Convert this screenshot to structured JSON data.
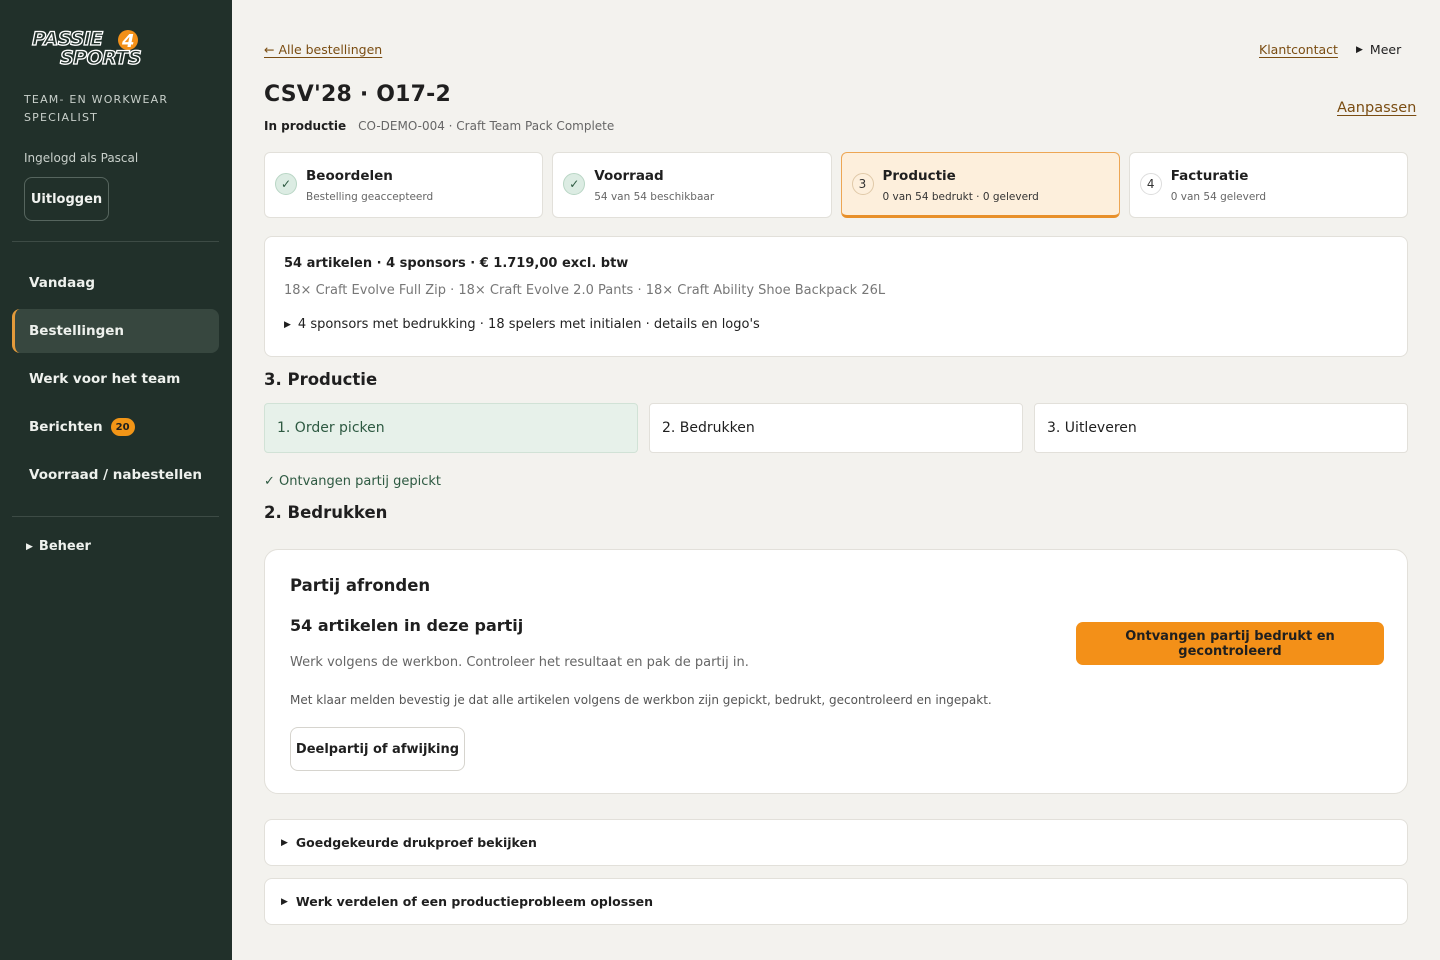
{
  "sidebar": {
    "logo_text_top": "PASSIE",
    "logo_text_num": "4",
    "logo_text_bottom": "SPORTS",
    "tagline": "TEAM- EN WORKWEAR SPECIALIST",
    "logged_in": "Ingelogd als Pascal",
    "logout_label": "Uitloggen",
    "nav": [
      {
        "label": "Vandaag"
      },
      {
        "label": "Bestellingen"
      },
      {
        "label": "Werk voor het team"
      },
      {
        "label": "Berichten",
        "badge": "20"
      },
      {
        "label": "Voorraad / nabestellen"
      }
    ],
    "beheer_label": "Beheer"
  },
  "header": {
    "back_link": "← Alle bestellingen",
    "klantcontact": "Klantcontact",
    "meer": "Meer",
    "title": "CSV'28 · O17-2",
    "status": "In productie",
    "meta": "CO-DEMO-004 · Craft Team Pack Complete",
    "aanpassen": "Aanpassen"
  },
  "steps": [
    {
      "label": "Beoordelen",
      "sub": "Bestelling geaccepteerd",
      "icon": "✓"
    },
    {
      "label": "Voorraad",
      "sub": "54 van 54 beschikbaar",
      "icon": "✓"
    },
    {
      "label": "Productie",
      "sub": "0 van 54 bedrukt · 0 geleverd",
      "icon": "3"
    },
    {
      "label": "Facturatie",
      "sub": "0 van 54 geleverd",
      "icon": "4"
    }
  ],
  "summary": {
    "headline": "54 artikelen · 4 sponsors · € 1.719,00 excl. btw",
    "items": "18× Craft Evolve Full Zip · 18× Craft Evolve 2.0 Pants · 18× Craft Ability Shoe Backpack 26L",
    "details": "4 sponsors met bedrukking · 18 spelers met initialen · details en logo's"
  },
  "production": {
    "title": "3. Productie",
    "subtabs": [
      "1. Order picken",
      "2. Bedrukken",
      "3. Uitleveren"
    ],
    "picked_note": "✓ Ontvangen partij gepickt",
    "subtitle": "2. Bedrukken"
  },
  "card": {
    "title": "Partij afronden",
    "count": "54 artikelen in deze partij",
    "text1": "Werk volgens de werkbon. Controleer het resultaat en pak de partij in.",
    "text2": "Met klaar melden bevestig je dat alle artikelen volgens de werkbon zijn gepickt, bedrukt, gecontroleerd en ingepakt.",
    "secondary_button": "Deelpartij of afwijking",
    "primary_button": "Ontvangen partij bedrukt en gecontroleerd"
  },
  "collapsibles": [
    "Goedgekeurde drukproef bekijken",
    "Werk verdelen of een productieprobleem oplossen"
  ],
  "colors": {
    "sidebar_bg": "#21302a",
    "accent_orange": "#f39018",
    "success_green": "#2e5a42",
    "link_brown": "#7a4d12"
  }
}
